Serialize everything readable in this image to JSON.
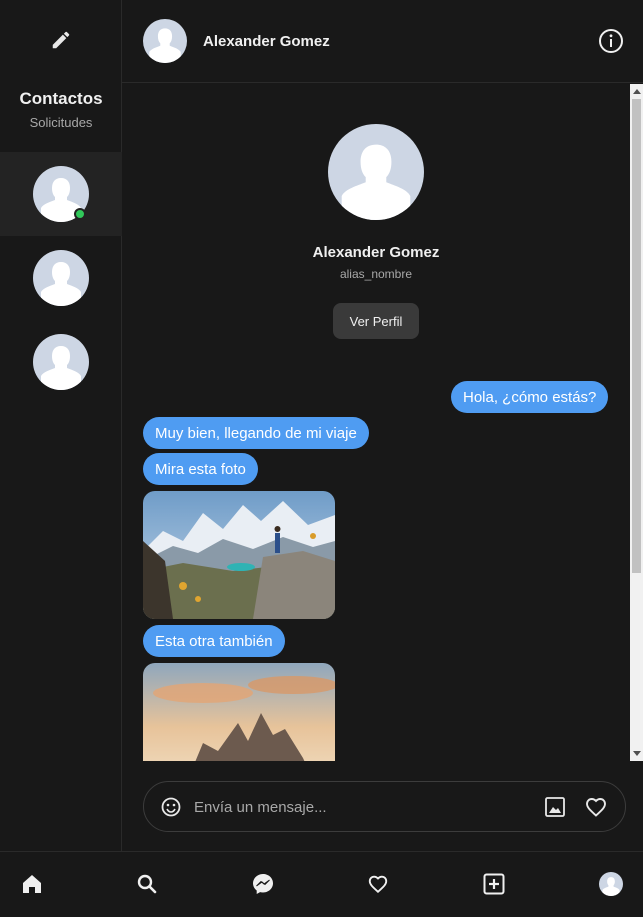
{
  "sidebar": {
    "title": "Contactos",
    "subtitle": "Solicitudes",
    "compose_icon": "pencil-icon",
    "contacts": [
      {
        "icon": "default-avatar",
        "online": true,
        "active": true
      },
      {
        "icon": "default-avatar",
        "online": false,
        "active": false
      },
      {
        "icon": "default-avatar",
        "online": false,
        "active": false
      }
    ]
  },
  "header": {
    "name": "Alexander Gomez",
    "info_icon": "info-icon"
  },
  "profile": {
    "name": "Alexander Gomez",
    "alias": "alias_nombre",
    "button_label": "Ver Perfil"
  },
  "messages": {
    "m1": "Hola, ¿cómo estás?",
    "m2": "Muy bien, llegando de mi viaje",
    "m3": "Mira esta foto",
    "m4": "Esta otra también"
  },
  "composer": {
    "placeholder": "Envía un mensaje...",
    "emoji_icon": "emoji-icon",
    "image_icon": "image-icon",
    "like_icon": "heart-icon"
  },
  "bottom_nav": {
    "items": [
      "home-icon",
      "search-icon",
      "messenger-icon",
      "heart-icon",
      "add-icon",
      "profile-avatar"
    ]
  },
  "colors": {
    "background": "#181818",
    "bubble": "#4f9cf2",
    "online": "#31c85a",
    "avatar_bg": "#cdd6e4"
  }
}
